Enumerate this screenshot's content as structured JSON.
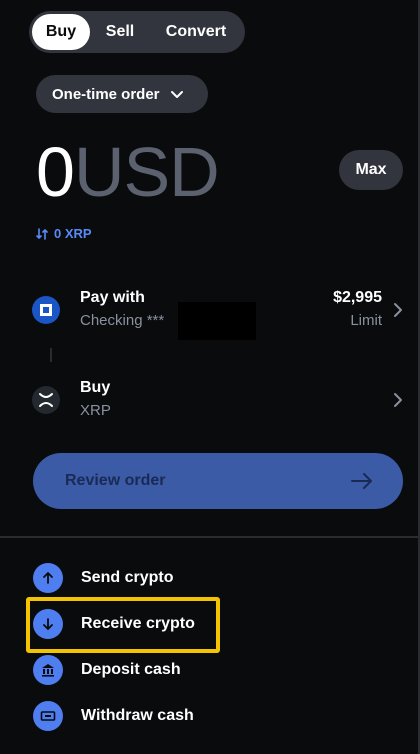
{
  "tabs": [
    {
      "label": "Buy",
      "active": true
    },
    {
      "label": "Sell",
      "active": false
    },
    {
      "label": "Convert",
      "active": false
    }
  ],
  "order_type": {
    "label": "One-time order"
  },
  "amount": {
    "value": "0",
    "currency": "USD"
  },
  "max_label": "Max",
  "conversion": {
    "text": "0 XRP"
  },
  "pay_with": {
    "title": "Pay with",
    "subtitle": "Checking ***",
    "limit_value": "$2,995",
    "limit_label": "Limit"
  },
  "buy": {
    "title": "Buy",
    "subtitle": "XRP"
  },
  "review_button": {
    "label": "Review order"
  },
  "actions": [
    {
      "label": "Send crypto",
      "icon": "arrow-up-icon"
    },
    {
      "label": "Receive crypto",
      "icon": "arrow-down-icon",
      "highlighted": true
    },
    {
      "label": "Deposit cash",
      "icon": "bank-icon"
    },
    {
      "label": "Withdraw cash",
      "icon": "cash-icon"
    }
  ],
  "colors": {
    "background": "#0a0b0d",
    "pill": "#32353d",
    "accent_blue": "#4f7ef0",
    "review_button": "#3b5ba6",
    "highlight": "#f5c400",
    "muted_text": "#8a919e"
  }
}
